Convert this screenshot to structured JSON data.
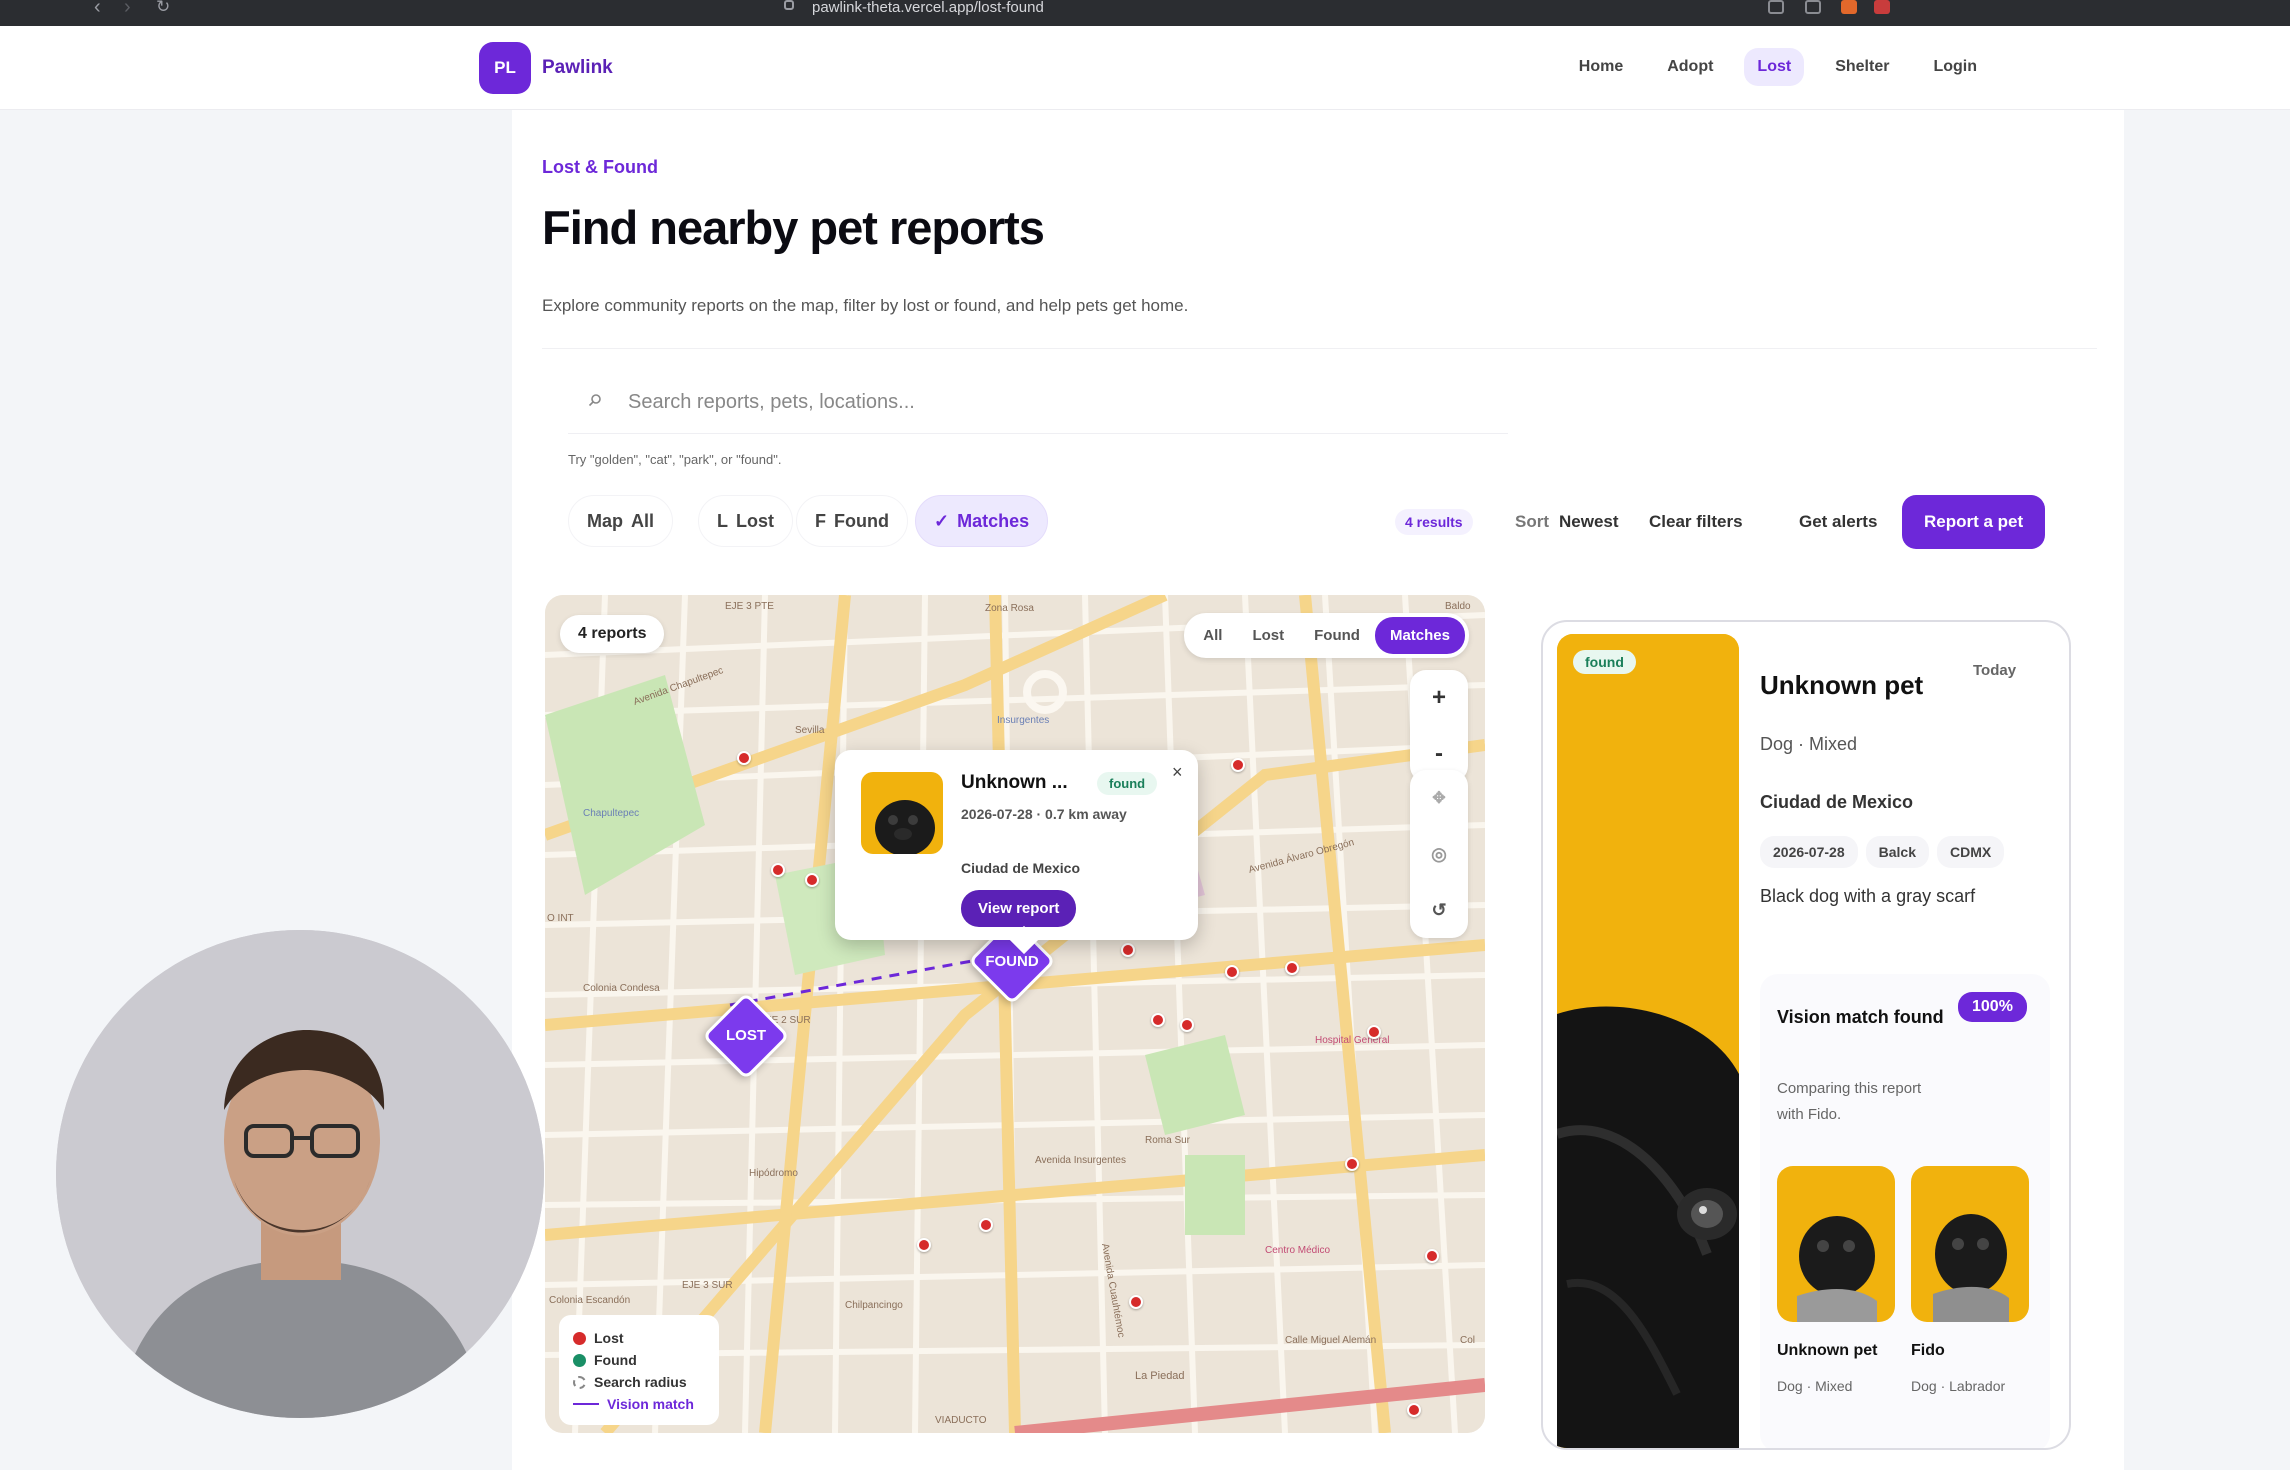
{
  "browser": {
    "url": "pawlink-theta.vercel.app/lost-found"
  },
  "header": {
    "logo_initials": "PL",
    "brand": "Pawlink",
    "nav": [
      {
        "label": "Home",
        "active": false
      },
      {
        "label": "Adopt",
        "active": false
      },
      {
        "label": "Lost",
        "active": true
      },
      {
        "label": "Shelter",
        "active": false
      },
      {
        "label": "Login",
        "active": false
      }
    ]
  },
  "page": {
    "eyebrow": "Lost & Found",
    "title": "Find nearby pet reports",
    "subtitle": "Explore community reports on the map, filter by lost or found, and help pets get home."
  },
  "search": {
    "placeholder": "Search reports, pets, locations...",
    "hint": "Try \"golden\", \"cat\", \"park\", or \"found\"."
  },
  "filters": {
    "chips": [
      {
        "key": "Map",
        "label": "All"
      },
      {
        "key": "L",
        "label": "Lost"
      },
      {
        "key": "F",
        "label": "Found"
      },
      {
        "key": "✓",
        "label": "Matches",
        "active": true
      }
    ],
    "results": "4 results",
    "sort_label": "Sort",
    "sort_value": "Newest",
    "clear": "Clear filters",
    "alerts": "Get alerts",
    "report": "Report a pet"
  },
  "map": {
    "count": "4 reports",
    "tabs": [
      "All",
      "Lost",
      "Found",
      "Matches"
    ],
    "active_tab": "Matches",
    "zoom_in": "+",
    "zoom_out": "-",
    "markers": {
      "lost": "LOST",
      "found": "FOUND"
    },
    "street_labels": [
      "EJE 3 PTE",
      "Zona Rosa",
      "Insurgentes",
      "Sevilla",
      "Chapultepec",
      "Colonia Condesa",
      "Hipódromo",
      "Avenida Chapultepec",
      "Avenida Álvaro Obregón",
      "EJE 2 SUR",
      "EJE 3 SUR",
      "Avenida Cuauhtémoc",
      "Hospital General",
      "Centro Médico",
      "Calle Miguel Alemán",
      "Colonia Escandón",
      "Chilpancingo",
      "La Piedad",
      "Roma Sur",
      "Avenida Insurgentes",
      "Colonia Escandon",
      "VIADUCTO",
      "O INT",
      "Baldo",
      "Col"
    ],
    "popup": {
      "title": "Unknown ...",
      "tag": "found",
      "close": "×",
      "meta": "2026-07-28 · 0.7 km away",
      "city": "Ciudad de Mexico",
      "button": "View report"
    },
    "legend": {
      "lost": "Lost",
      "found": "Found",
      "radius": "Search radius",
      "vision": "Vision match"
    },
    "colors": {
      "lost": "#d62b2b",
      "found": "#1a8f66",
      "accent": "#6d28d9"
    }
  },
  "detail": {
    "status": "found",
    "date_label": "Today",
    "name": "Unknown pet",
    "species": "Dog · Mixed",
    "city": "Ciudad de Mexico",
    "chips": [
      "2026-07-28",
      "Balck",
      "CDMX"
    ],
    "description": "Black dog with a gray scarf",
    "vision": {
      "title": "Vision match found",
      "percent": "100%",
      "desc": "Comparing this report with Fido.",
      "a_name": "Unknown pet",
      "a_species": "Dog · Mixed",
      "b_name": "Fido",
      "b_species": "Dog · Labrador"
    }
  }
}
